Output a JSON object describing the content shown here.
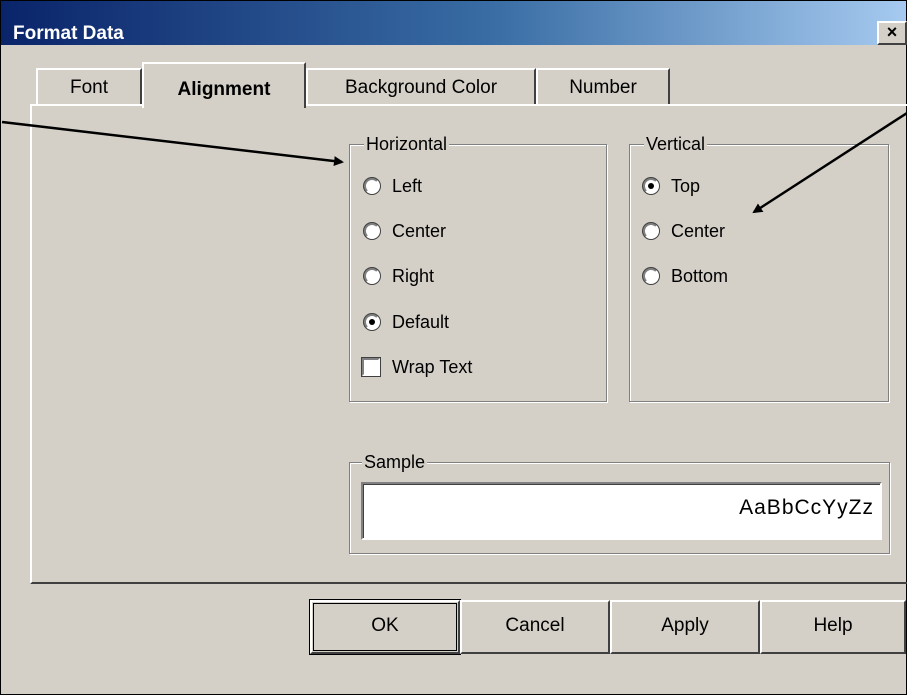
{
  "window": {
    "title": "Format Data",
    "close_glyph": "×"
  },
  "tabs": [
    {
      "label": "Font",
      "active": false
    },
    {
      "label": "Alignment",
      "active": true
    },
    {
      "label": "Background Color",
      "active": false
    },
    {
      "label": "Number",
      "active": false
    }
  ],
  "horizontal": {
    "legend": "Horizontal",
    "options": [
      {
        "label": "Left",
        "checked": false
      },
      {
        "label": "Center",
        "checked": false
      },
      {
        "label": "Right",
        "checked": false
      },
      {
        "label": "Default",
        "checked": true
      }
    ],
    "wrap_label": "Wrap Text",
    "wrap_checked": false
  },
  "vertical": {
    "legend": "Vertical",
    "options": [
      {
        "label": "Top",
        "checked": true
      },
      {
        "label": "Center",
        "checked": false
      },
      {
        "label": "Bottom",
        "checked": false
      }
    ]
  },
  "sample": {
    "legend": "Sample",
    "text": "AaBbCcYyZz"
  },
  "buttons": {
    "ok": "OK",
    "cancel": "Cancel",
    "apply": "Apply",
    "help": "Help"
  },
  "colors": {
    "dialog_bg": "#d4d0c8",
    "title_start": "#0a246a",
    "title_end": "#a6caf0"
  },
  "icons": {
    "close": "close-icon",
    "arrows": "annotation-arrow"
  }
}
